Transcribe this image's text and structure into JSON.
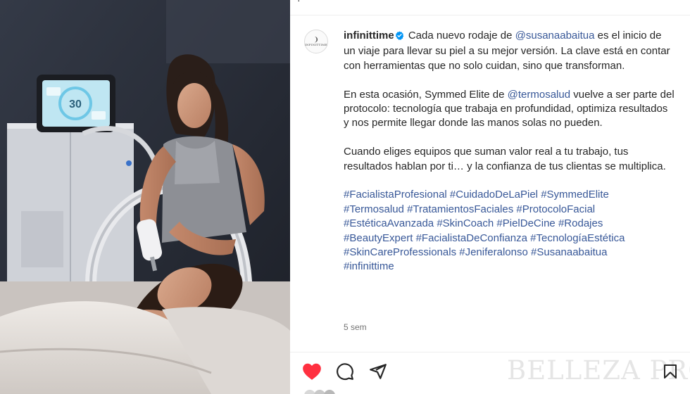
{
  "post": {
    "username": "infinittime",
    "avatar": {
      "mark": "❩",
      "brand": "INFINITTIME"
    },
    "caption": {
      "p1": {
        "intro": "Cada nuevo rodaje de ",
        "mention": "@susanaabaitua",
        "rest": " es el inicio de un viaje para llevar su piel a su mejor versión. La clave está en contar con herramientas que no solo cuidan, sino que transforman."
      },
      "p2": {
        "intro": "En esta ocasión, Symmed Elite de ",
        "mention": "@termosalud",
        "rest": " vuelve a ser parte del protocolo: tecnología que trabaja en profundidad, optimiza resultados y nos permite llegar donde las manos solas no pueden."
      },
      "p3": "Cuando eliges equipos que suman valor real a tu trabajo, tus resultados hablan por ti… y la confianza de tus clientas se multiplica."
    },
    "hashtags": [
      "#FacialistaProfesional",
      "#CuidadoDeLaPiel",
      "#SymmedElite",
      "#Termosalud",
      "#TratamientosFaciales",
      "#ProtocoloFacial",
      "#EstéticaAvanzada",
      "#SkinCoach",
      "#PielDeCine",
      "#Rodajes",
      "#BeautyExpert",
      "#FacialistaDeConfianza",
      "#TecnologíaEstética",
      "#SkinCareProfessionals",
      "#Jeniferalonso",
      "#Susanaabaitua",
      "#infinittime"
    ],
    "timestamp": "5 sem"
  },
  "photo": {
    "device_screen_value": "30"
  },
  "actions": {
    "like": "heart-icon",
    "comment": "comment-icon",
    "share": "share-icon",
    "save": "bookmark-icon"
  },
  "watermark": "BELLEZA PRO",
  "colors": {
    "like_red": "#ff3040",
    "link_blue": "#385898",
    "muted": "#737373"
  }
}
